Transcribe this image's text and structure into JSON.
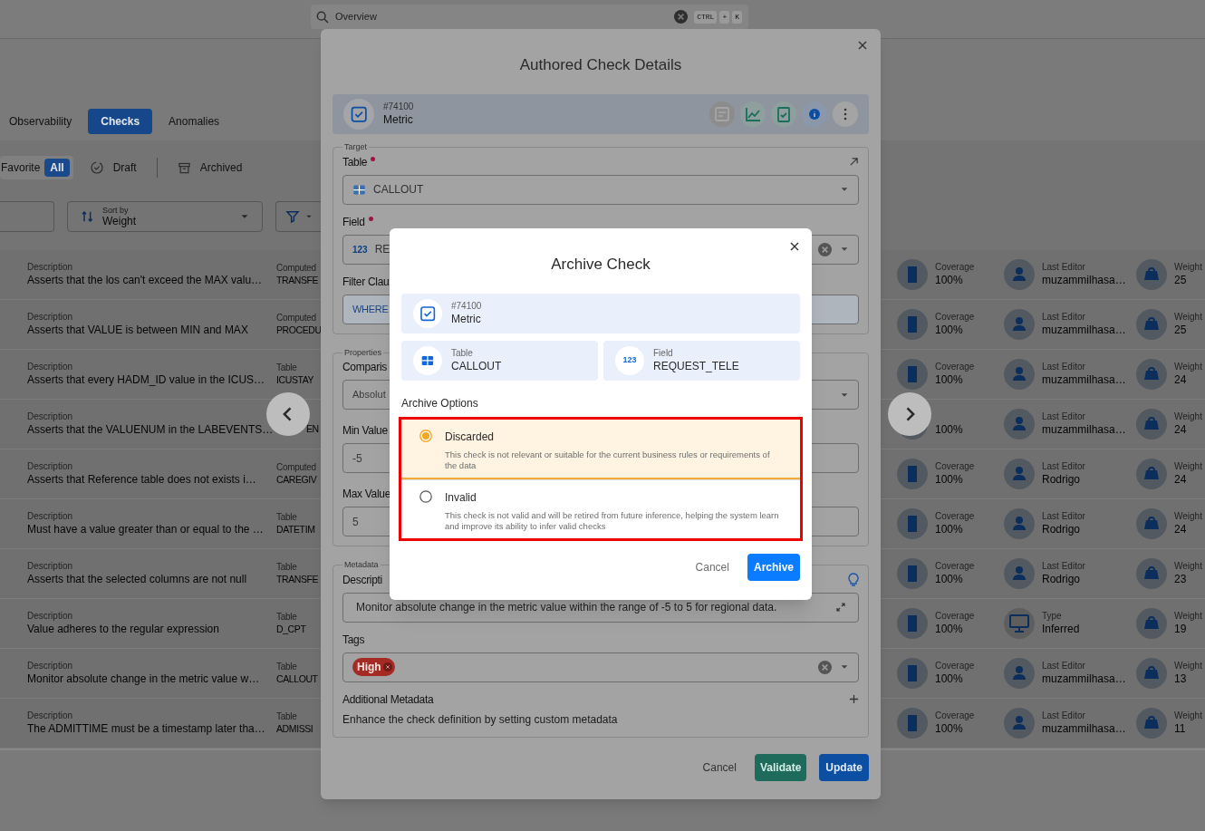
{
  "search": {
    "placeholder": "Overview",
    "keys": [
      "CTRL",
      "+",
      "K"
    ]
  },
  "tabs": [
    {
      "label": "Observability",
      "selected": false
    },
    {
      "label": "Checks",
      "selected": true
    },
    {
      "label": "Anomalies",
      "selected": false
    }
  ],
  "filters": [
    {
      "label": "Favorite",
      "selected": false,
      "kind": "chip"
    },
    {
      "label": "All",
      "selected": true,
      "kind": "chip"
    },
    {
      "label": "Draft",
      "selected": false,
      "kind": "draft"
    },
    {
      "label": "Archived",
      "selected": false,
      "kind": "archived"
    }
  ],
  "sort": {
    "label": "Sort by",
    "value": "Weight"
  },
  "checks": [
    {
      "description_label": "Description",
      "description": "Asserts that the los can't exceed the MAX valu…",
      "column_2_label": "Computed",
      "column_2": "TRANSFE",
      "coverage_label": "Coverage",
      "coverage": "100%",
      "editor": {
        "kind": "user",
        "label": "Last Editor",
        "name": "muzammilhasa…"
      },
      "weight_label": "Weight",
      "weight": "25"
    },
    {
      "description_label": "Description",
      "description": "Asserts that VALUE is between MIN and MAX",
      "column_2_label": "Computed",
      "column_2": "PROCEDU",
      "coverage_label": "Coverage",
      "coverage": "100%",
      "editor": {
        "kind": "user",
        "label": "Last Editor",
        "name": "muzammilhasa…"
      },
      "weight_label": "Weight",
      "weight": "25"
    },
    {
      "description_label": "Description",
      "description": "Asserts that every HADM_ID value in the ICUS…",
      "column_2_label": "Table",
      "column_2": "ICUSTAY",
      "coverage_label": "Coverage",
      "coverage": "100%",
      "editor": {
        "kind": "user",
        "label": "Last Editor",
        "name": "muzammilhasa…"
      },
      "weight_label": "Weight",
      "weight": "24"
    },
    {
      "description_label": "Description",
      "description": "Asserts that the VALUENUM in the LABEVENTS…",
      "column_2": "EN",
      "coverage": "100%",
      "editor": {
        "kind": "user",
        "label": "Last Editor",
        "name": "muzammilhasa…"
      },
      "weight_label": "Weight",
      "weight": "24"
    },
    {
      "description_label": "Description",
      "description": "Asserts that Reference table does not exists i…",
      "column_2_label": "Computed",
      "column_2": "CAREGIV",
      "coverage_label": "Coverage",
      "coverage": "100%",
      "editor": {
        "kind": "user",
        "label": "Last Editor",
        "name": "Rodrigo"
      },
      "weight_label": "Weight",
      "weight": "24"
    },
    {
      "description_label": "Description",
      "description": "Must have a value greater than or equal to the …",
      "column_2_label": "Table",
      "column_2": "DATETIM",
      "coverage_label": "Coverage",
      "coverage": "100%",
      "editor": {
        "kind": "user",
        "label": "Last Editor",
        "name": "Rodrigo"
      },
      "weight_label": "Weight",
      "weight": "24"
    },
    {
      "description_label": "Description",
      "description": "Asserts that the selected columns are not null",
      "column_2_label": "Table",
      "column_2": "TRANSFE",
      "coverage_label": "Coverage",
      "coverage": "100%",
      "editor": {
        "kind": "user",
        "label": "Last Editor",
        "name": "Rodrigo"
      },
      "weight_label": "Weight",
      "weight": "23"
    },
    {
      "description_label": "Description",
      "description": "Value adheres to the regular expression",
      "column_2_label": "Table",
      "column_2": "D_CPT",
      "coverage_label": "Coverage",
      "coverage": "100%",
      "editor": {
        "kind": "type",
        "label": "Type",
        "name": "Inferred"
      },
      "weight_label": "Weight",
      "weight": "19"
    },
    {
      "description_label": "Description",
      "description": "Monitor absolute change in the metric value w…",
      "column_2_label": "Table",
      "column_2": "CALLOUT",
      "coverage_label": "Coverage",
      "coverage": "100%",
      "editor": {
        "kind": "user",
        "label": "Last Editor",
        "name": "muzammilhasa…"
      },
      "weight_label": "Weight",
      "weight": "13"
    },
    {
      "description_label": "Description",
      "description": "The ADMITTIME must be a timestamp later tha…",
      "column_2_label": "Table",
      "column_2": "ADMISSI",
      "coverage_label": "Coverage",
      "coverage": "100%",
      "editor": {
        "kind": "user",
        "label": "Last Editor",
        "name": "muzammilhasa…"
      },
      "weight_label": "Weight",
      "weight": "11"
    }
  ],
  "details": {
    "title": "Authored Check Details",
    "check": {
      "id": "#74100",
      "type": "Metric"
    },
    "target": {
      "legend": "Target",
      "table_label": "Table",
      "table_required": true,
      "table": "CALLOUT",
      "field_label": "Field",
      "field_required": true,
      "field_badge": "123",
      "field": "RE",
      "filter_label": "Filter Clau",
      "filter": "WHERE"
    },
    "properties": {
      "legend": "Properties",
      "comparison_label": "Comparis",
      "comparison": "Absolut",
      "min_label": "Min Value",
      "min": "-5",
      "max_label": "Max Value",
      "max": "5"
    },
    "metadata": {
      "legend": "Metadata",
      "description_label": "Descripti",
      "description": "Monitor absolute change in the metric value within the range of -5 to 5 for regional data.",
      "tags_label": "Tags",
      "tags": [
        {
          "label": "High",
          "color": "#a52a23"
        }
      ],
      "additional_label": "Additional Metadata",
      "additional_hint": "Enhance the check definition by setting custom metadata"
    },
    "buttons": [
      {
        "label": "Cancel",
        "kind": "text"
      },
      {
        "label": "Validate",
        "kind": "success"
      },
      {
        "label": "Update",
        "kind": "primary"
      }
    ]
  },
  "archive_dialog": {
    "title": "Archive Check",
    "check": {
      "id": "#74100",
      "type": "Metric"
    },
    "target": [
      {
        "kind": "table",
        "label": "Table",
        "value": "CALLOUT"
      },
      {
        "kind": "field",
        "badge": "123",
        "label": "Field",
        "value": "REQUEST_TELE"
      }
    ],
    "options_label": "Archive Options",
    "options": [
      {
        "label": "Discarded",
        "description": "This check is not relevant or suitable for the current business rules or requirements of the data",
        "selected": true
      },
      {
        "label": "Invalid",
        "description": "This check is not valid and will be retired from future inference, helping the system learn and improve its ability to infer valid checks",
        "selected": false
      }
    ],
    "buttons": [
      {
        "label": "Cancel",
        "kind": "text"
      },
      {
        "label": "Archive",
        "kind": "primary"
      }
    ]
  }
}
